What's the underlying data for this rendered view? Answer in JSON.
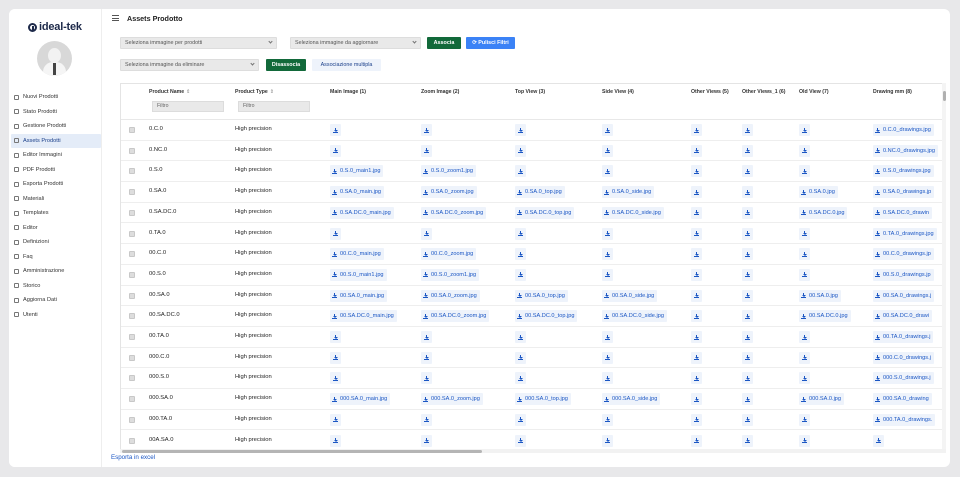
{
  "app": {
    "brand": "ideal-tek",
    "page_title": "Assets Prodotto"
  },
  "sidebar": {
    "items": [
      {
        "label": "Nuovi Prodotti",
        "icon": "list-icon"
      },
      {
        "label": "Stato Prodotti",
        "icon": "refresh-icon"
      },
      {
        "label": "Gestione Prodotti",
        "icon": "list-icon"
      },
      {
        "label": "Assets Prodotti",
        "icon": "image-icon",
        "active": true
      },
      {
        "label": "Editor Immagini",
        "icon": "edit-icon"
      },
      {
        "label": "PDF Prodotti",
        "icon": "pdf-icon"
      },
      {
        "label": "Esporta Prodotti",
        "icon": "export-icon"
      },
      {
        "label": "Materiali",
        "icon": "material-icon"
      },
      {
        "label": "Templates",
        "icon": "template-icon"
      },
      {
        "label": "Editor",
        "icon": "edit-icon"
      },
      {
        "label": "Definizioni",
        "icon": "definition-icon"
      },
      {
        "label": "Faq",
        "icon": "help-icon"
      },
      {
        "label": "Amministrazione",
        "icon": "settings-icon"
      },
      {
        "label": "Storico",
        "icon": "history-icon"
      },
      {
        "label": "Aggiorna Dati",
        "icon": "sync-icon"
      },
      {
        "label": "Utenti",
        "icon": "users-icon"
      }
    ]
  },
  "toolbar": {
    "select_products": "Seleziona immagine per prodotti",
    "select_update": "Seleziona immagine da aggiornare",
    "associa": "Associa",
    "pulisci": "Pulisci Filtri",
    "select_delete": "Seleziona immagine da eliminare",
    "disassocia": "Disassocia",
    "multipla": "Associazione multipla"
  },
  "table": {
    "headers": [
      "Product Name",
      "Product Type",
      "Main Image (1)",
      "Zoom Image (2)",
      "Top View (3)",
      "Side View (4)",
      "Other Views (5)",
      "Other Views_1 (6)",
      "Old View (7)",
      "Drawing mm (8)"
    ],
    "filter_placeholder": "Filtro",
    "rows": [
      {
        "name": "0.C.0",
        "type": "High precision",
        "files": [
          "",
          "",
          "",
          "",
          "",
          "",
          "",
          "0.C.0_drawings.jpg"
        ]
      },
      {
        "name": "0.NC.0",
        "type": "High precision",
        "files": [
          "",
          "",
          "",
          "",
          "",
          "",
          "",
          "0.NC.0_drawings.jpg"
        ]
      },
      {
        "name": "0.S.0",
        "type": "High precision",
        "files": [
          "0.S.0_main1.jpg",
          "0.S.0_zoom1.jpg",
          "",
          "",
          "",
          "",
          "",
          "0.S.0_drawings.jpg"
        ]
      },
      {
        "name": "0.SA.0",
        "type": "High precision",
        "files": [
          "0.SA.0_main.jpg",
          "0.SA.0_zoom.jpg",
          "0.SA.0_top.jpg",
          "0.SA.0_side.jpg",
          "",
          "",
          "0.SA.0.jpg",
          "0.SA.0_drawings.jp"
        ]
      },
      {
        "name": "0.SA.DC.0",
        "type": "High precision",
        "files": [
          "0.SA.DC.0_main.jpg",
          "0.SA.DC.0_zoom.jpg",
          "0.SA.DC.0_top.jpg",
          "0.SA.DC.0_side.jpg",
          "",
          "",
          "0.SA.DC.0.jpg",
          "0.SA.DC.0_drawin"
        ]
      },
      {
        "name": "0.TA.0",
        "type": "High precision",
        "files": [
          "",
          "",
          "",
          "",
          "",
          "",
          "",
          "0.TA.0_drawings.jpg"
        ]
      },
      {
        "name": "00.C.0",
        "type": "High precision",
        "files": [
          "00.C.0_main.jpg",
          "00.C.0_zoom.jpg",
          "",
          "",
          "",
          "",
          "",
          "00.C.0_drawings.jp"
        ]
      },
      {
        "name": "00.S.0",
        "type": "High precision",
        "files": [
          "00.S.0_main1.jpg",
          "00.S.0_zoom1.jpg",
          "",
          "",
          "",
          "",
          "",
          "00.S.0_drawings.jp"
        ]
      },
      {
        "name": "00.SA.0",
        "type": "High precision",
        "files": [
          "00.SA.0_main.jpg",
          "00.SA.0_zoom.jpg",
          "00.SA.0_top.jpg",
          "00.SA.0_side.jpg",
          "",
          "",
          "00.SA.0.jpg",
          "00.SA.0_drawings.j"
        ]
      },
      {
        "name": "00.SA.DC.0",
        "type": "High precision",
        "files": [
          "00.SA.DC.0_main.jpg",
          "00.SA.DC.0_zoom.jpg",
          "00.SA.DC.0_top.jpg",
          "00.SA.DC.0_side.jpg",
          "",
          "",
          "00.SA.DC.0.jpg",
          "00.SA.DC.0_drawi"
        ]
      },
      {
        "name": "00.TA.0",
        "type": "High precision",
        "files": [
          "",
          "",
          "",
          "",
          "",
          "",
          "",
          "00.TA.0_drawings.j"
        ]
      },
      {
        "name": "000.C.0",
        "type": "High precision",
        "files": [
          "",
          "",
          "",
          "",
          "",
          "",
          "",
          "000.C.0_drawings.j"
        ]
      },
      {
        "name": "000.S.0",
        "type": "High precision",
        "files": [
          "",
          "",
          "",
          "",
          "",
          "",
          "",
          "000.S.0_drawings.j"
        ]
      },
      {
        "name": "000.SA.0",
        "type": "High precision",
        "files": [
          "000.SA.0_main.jpg",
          "000.SA.0_zoom.jpg",
          "000.SA.0_top.jpg",
          "000.SA.0_side.jpg",
          "",
          "",
          "000.SA.0.jpg",
          "000.SA.0_drawing"
        ]
      },
      {
        "name": "000.TA.0",
        "type": "High precision",
        "files": [
          "",
          "",
          "",
          "",
          "",
          "",
          "",
          "000.TA.0_drawings."
        ]
      },
      {
        "name": "00A.SA.0",
        "type": "High precision",
        "files": [
          "",
          "",
          "",
          "",
          "",
          "",
          "",
          ""
        ]
      }
    ]
  },
  "footer": {
    "export": "Esporta in excel"
  },
  "colors": {
    "green": "#12693a",
    "blue": "#3b82f6",
    "link": "#1a56c4",
    "active_bg": "#e4ecf8"
  }
}
